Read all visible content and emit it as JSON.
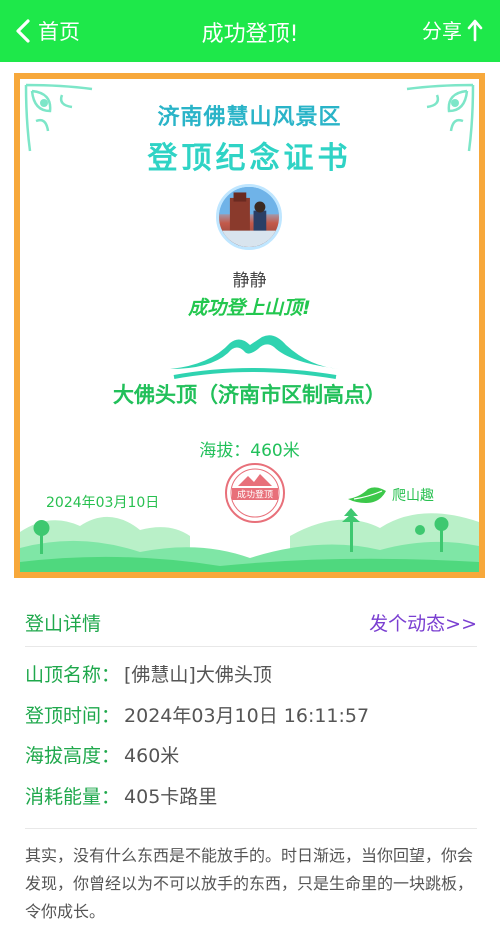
{
  "topbar": {
    "back_label": "首页",
    "title": "成功登顶!",
    "share_label": "分享",
    "background": "#1ee84a"
  },
  "certificate": {
    "scenic_name": "济南佛慧山风景区",
    "title": "登顶纪念证书",
    "user_name": "静静",
    "success_text": "成功登上山顶!",
    "peak_name": "大佛头顶（济南市区制高点）",
    "altitude": "海拔：460米",
    "date": "2024年03月10日",
    "stamp_text": "成功登顶",
    "brand": "爬山趣",
    "border_color": "#f7a83b"
  },
  "details": {
    "header": "登山详情",
    "post_link": "发个动态>>",
    "rows": [
      {
        "key": "山顶名称：",
        "value": "[佛慧山]大佛头顶"
      },
      {
        "key": "登顶时间：",
        "value": "2024年03月10日 16:11:57"
      },
      {
        "key": "海拔高度：",
        "value": "460米"
      },
      {
        "key": "消耗能量：",
        "value": "405卡路里"
      }
    ],
    "quote": "其实，没有什么东西是不能放手的。时日渐远，当你回望，你会发现，你曾经以为不可以放手的东西，只是生命里的一块跳板，令你成长。"
  }
}
